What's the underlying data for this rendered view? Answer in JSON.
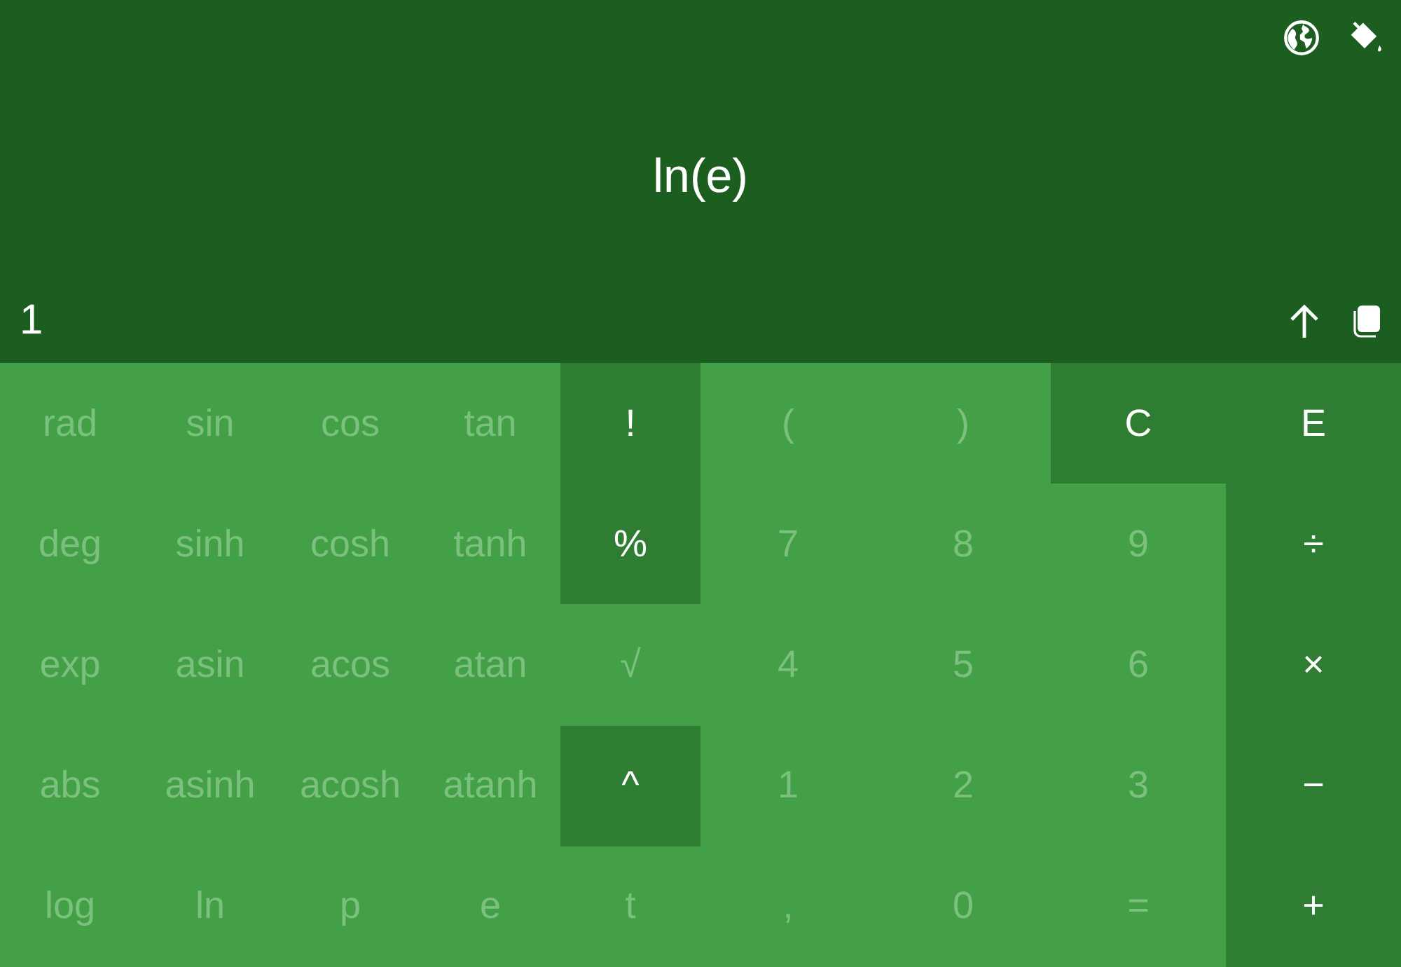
{
  "display": {
    "expression": "ln(e)",
    "result": "1"
  },
  "keys": [
    [
      {
        "label": "rad",
        "disabled": true
      },
      {
        "label": "sin",
        "disabled": true
      },
      {
        "label": "cos",
        "disabled": true
      },
      {
        "label": "tan",
        "disabled": true
      },
      {
        "label": "!",
        "disabled": false
      },
      {
        "label": "(",
        "disabled": true
      },
      {
        "label": ")",
        "disabled": true
      },
      {
        "label": "C",
        "disabled": false
      },
      {
        "label": "E",
        "disabled": false
      }
    ],
    [
      {
        "label": "deg",
        "disabled": true
      },
      {
        "label": "sinh",
        "disabled": true
      },
      {
        "label": "cosh",
        "disabled": true
      },
      {
        "label": "tanh",
        "disabled": true
      },
      {
        "label": "%",
        "disabled": false
      },
      {
        "label": "7",
        "disabled": true
      },
      {
        "label": "8",
        "disabled": true
      },
      {
        "label": "9",
        "disabled": true
      },
      {
        "label": "÷",
        "disabled": false
      }
    ],
    [
      {
        "label": "exp",
        "disabled": true
      },
      {
        "label": "asin",
        "disabled": true
      },
      {
        "label": "acos",
        "disabled": true
      },
      {
        "label": "atan",
        "disabled": true
      },
      {
        "label": "√",
        "disabled": true
      },
      {
        "label": "4",
        "disabled": true
      },
      {
        "label": "5",
        "disabled": true
      },
      {
        "label": "6",
        "disabled": true
      },
      {
        "label": "×",
        "disabled": false
      }
    ],
    [
      {
        "label": "abs",
        "disabled": true
      },
      {
        "label": "asinh",
        "disabled": true
      },
      {
        "label": "acosh",
        "disabled": true
      },
      {
        "label": "atanh",
        "disabled": true
      },
      {
        "label": "^",
        "disabled": false
      },
      {
        "label": "1",
        "disabled": true
      },
      {
        "label": "2",
        "disabled": true
      },
      {
        "label": "3",
        "disabled": true
      },
      {
        "label": "−",
        "disabled": false
      }
    ],
    [
      {
        "label": "log",
        "disabled": true
      },
      {
        "label": "ln",
        "disabled": true
      },
      {
        "label": "p",
        "disabled": true
      },
      {
        "label": "e",
        "disabled": true
      },
      {
        "label": "t",
        "disabled": true
      },
      {
        "label": ",",
        "disabled": true
      },
      {
        "label": "0",
        "disabled": true
      },
      {
        "label": "=",
        "disabled": true
      },
      {
        "label": "+",
        "disabled": false
      }
    ]
  ]
}
